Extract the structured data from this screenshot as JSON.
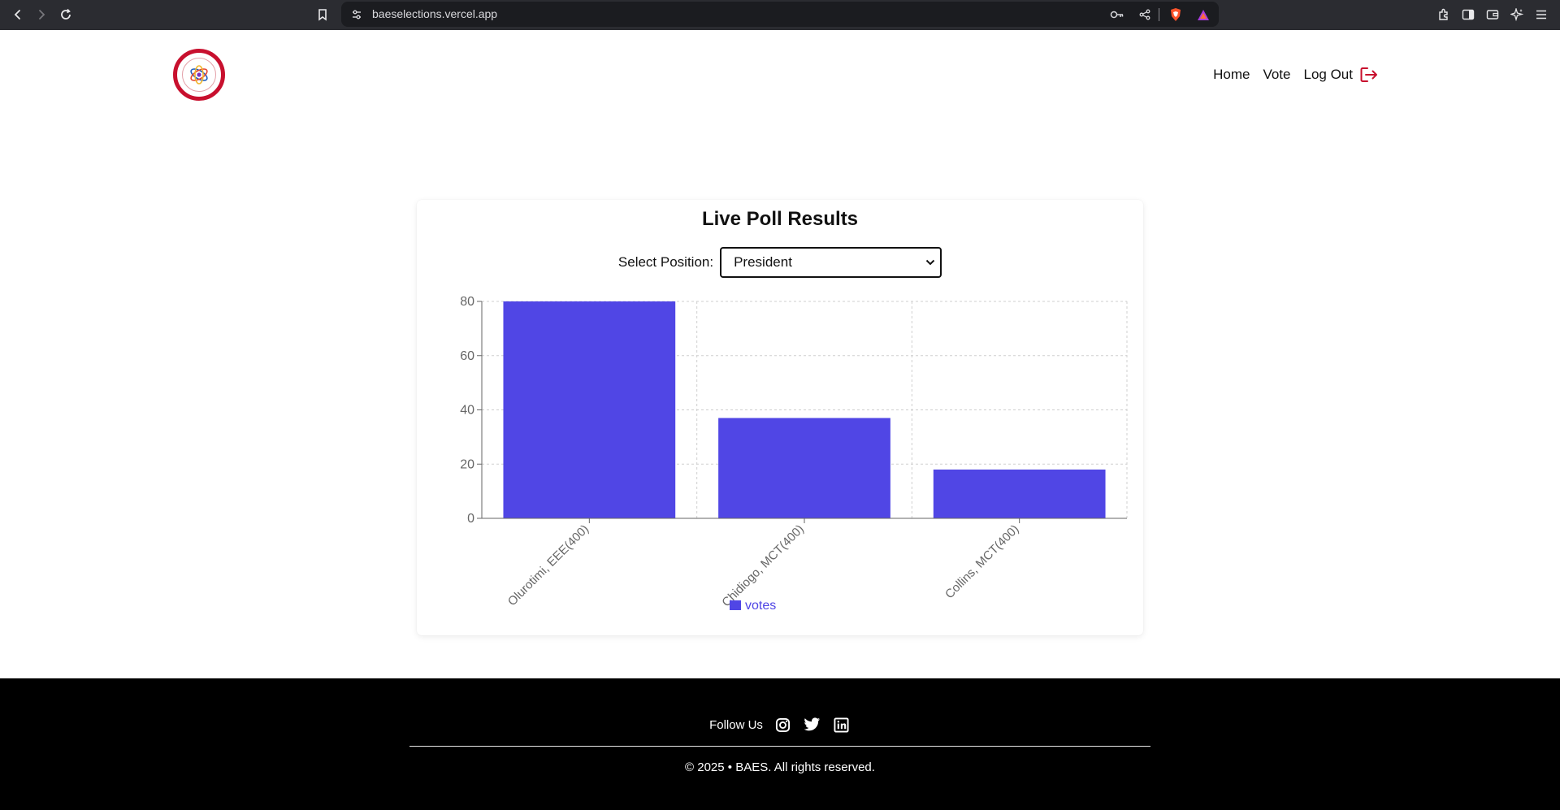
{
  "browser": {
    "url": "baeselections.vercel.app",
    "icons": [
      "back-icon",
      "forward-icon",
      "reload-icon",
      "bookmark-icon",
      "site-settings-icon",
      "key-icon",
      "share-icon",
      "brave-shield-icon",
      "brave-rewards-icon",
      "extensions-icon",
      "sidebar-icon",
      "wallet-icon",
      "leo-ai-icon",
      "menu-icon"
    ]
  },
  "nav": {
    "home": "Home",
    "vote": "Vote",
    "logout": "Log Out"
  },
  "poll": {
    "title": "Live Poll Results",
    "select_label": "Select Position:",
    "selected_position": "President"
  },
  "chart_data": {
    "type": "bar",
    "categories": [
      "Olurotimi, EEE(400)",
      "Chidiogo, MCT(400)",
      "Collins, MCT(400)"
    ],
    "series": [
      {
        "name": "votes",
        "values": [
          80,
          37,
          18
        ]
      }
    ],
    "ylim": [
      0,
      80
    ],
    "yticks": [
      0,
      20,
      40,
      60,
      80
    ],
    "grid": true,
    "legend": "bottom",
    "bar_color": "#5046e5"
  },
  "footer": {
    "follow_label": "Follow Us",
    "social_icons": [
      "instagram-icon",
      "twitter-icon",
      "linkedin-icon"
    ],
    "copyright": "© 2025 • BAES. All rights reserved."
  },
  "colors": {
    "accent": "#5046e5",
    "logo_red": "#c8102e",
    "logout_icon": "#c8102e",
    "footer_bg": "#000000",
    "browser_bg": "#2b2c31"
  }
}
